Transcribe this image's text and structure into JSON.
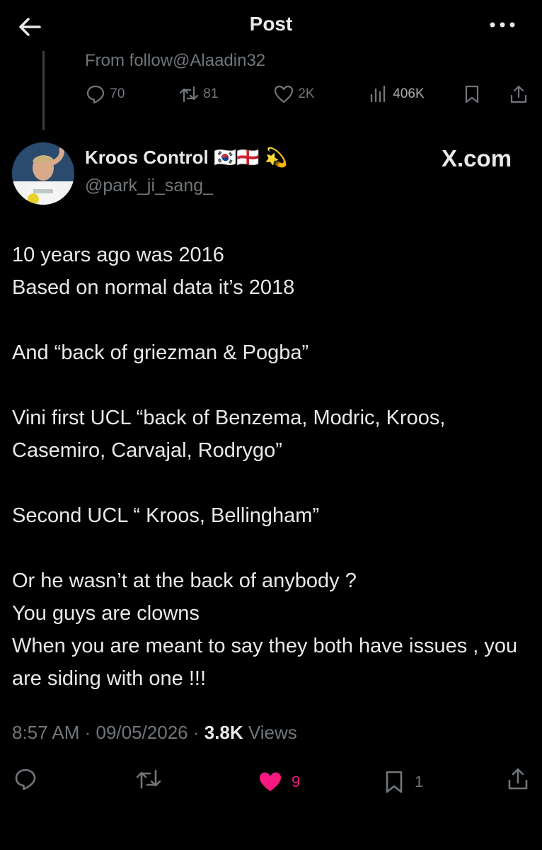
{
  "header": {
    "title": "Post"
  },
  "parent": {
    "from_text": "From follow@Alaadin32",
    "replies": "70",
    "reposts": "81",
    "likes": "2K",
    "views": "406K"
  },
  "author": {
    "display_name": "Kroos Control 🇰🇷🏴󠁧󠁢󠁥󠁮󠁧󠁿 💫",
    "handle": "@park_ji_sang_"
  },
  "watermark": "X.com",
  "tweet": {
    "lines": [
      "10 years ago was 2016\nBased on normal data it’s 2018",
      "And “back of griezman & Pogba”",
      "Vini first UCL “back of Benzema, Modric, Kroos, Casemiro, Carvajal, Rodrygo”",
      "Second UCL “ Kroos, Bellingham”",
      "Or he wasn’t at the back of anybody ?\nYou guys are clowns\nWhen you are meant to say they both have issues , you are siding with one !!!"
    ]
  },
  "meta": {
    "time_date": "8:57 AM · 09/05/2026 · ",
    "views_count": "3.8K",
    "views_label": " Views"
  },
  "actions": {
    "likes": "9",
    "bookmarks": "1",
    "like_color": "#f91880"
  },
  "icons": [
    "back-arrow-icon",
    "more-icon",
    "reply-icon",
    "repost-icon",
    "like-icon",
    "views-icon",
    "bookmark-icon",
    "share-icon"
  ]
}
